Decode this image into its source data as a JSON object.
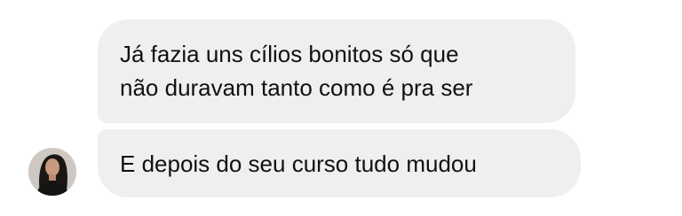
{
  "conversation": {
    "messages": [
      {
        "sender": "contact",
        "lines": [
          "Já fazia uns cílios bonitos só que",
          "não duravam tanto como é pra ser"
        ]
      },
      {
        "sender": "contact",
        "lines": [
          "E depois do seu curso tudo mudou"
        ]
      }
    ],
    "avatar_icon": "profile-photo",
    "colors": {
      "bubble_background": "#efefef",
      "text": "#111111",
      "page_background": "#ffffff"
    }
  }
}
